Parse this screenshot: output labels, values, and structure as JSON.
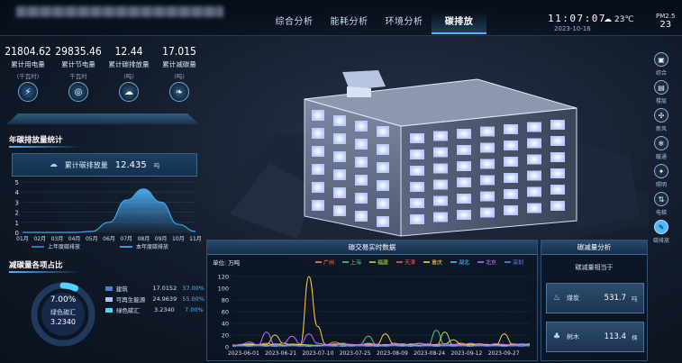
{
  "header": {
    "tabs": [
      {
        "label": "综合分析",
        "active": false
      },
      {
        "label": "能耗分析",
        "active": false
      },
      {
        "label": "环境分析",
        "active": false
      },
      {
        "label": "碳排放",
        "active": true
      }
    ],
    "time": "11:07:07",
    "date": "2023-10-16",
    "weather_icon": "cloud-sun-icon",
    "temperature": "23℃",
    "pm_label": "PM2.5",
    "pm_value": "23"
  },
  "stats": [
    {
      "value": "21804.62",
      "label": "累计用电量",
      "unit": "(千瓦时)",
      "icon": "lightning-icon"
    },
    {
      "value": "29835.46",
      "label": "累计节电量",
      "unit": "千瓦时",
      "icon": "target-icon"
    },
    {
      "value": "12.44",
      "label": "累计碳排放量",
      "unit": "(吨)",
      "icon": "cloud-icon"
    },
    {
      "value": "17.015",
      "label": "累计减碳量",
      "unit": "(吨)",
      "icon": "leaf-icon"
    }
  ],
  "annual": {
    "title": "年碳排放量统计",
    "total_label": "累计碳排放量",
    "total_value": "12.435",
    "total_unit": "吨"
  },
  "reduction": {
    "title": "减碳量各项占比",
    "center_percent": "7.00%",
    "center_label": "绿色碳汇",
    "center_value": "3.2340",
    "items": [
      {
        "name": "建筑",
        "value": "17.0152",
        "percent": "37.00%",
        "color": "#4a7fd6"
      },
      {
        "name": "可再生能源",
        "value": "24.9639",
        "percent": "55.00%",
        "color": "#a9c8f2"
      },
      {
        "name": "绿色碳汇",
        "value": "3.2340",
        "percent": "7.00%",
        "color": "#4fd2ff"
      }
    ]
  },
  "rail": [
    {
      "label": "综合",
      "icon": "overview-icon",
      "active": false
    },
    {
      "label": "楼层",
      "icon": "floors-icon",
      "active": false
    },
    {
      "label": "新风",
      "icon": "fan-icon",
      "active": false
    },
    {
      "label": "暖通",
      "icon": "hvac-icon",
      "active": false
    },
    {
      "label": "照明",
      "icon": "light-icon",
      "active": false
    },
    {
      "label": "电梯",
      "icon": "elevator-icon",
      "active": false
    },
    {
      "label": "碳排放",
      "icon": "carbon-icon",
      "active": true
    }
  ],
  "trade": {
    "title": "碳交易实时数据",
    "unit_label": "单位: 万吨"
  },
  "reduction_analysis": {
    "title": "碳减量分析",
    "equivalent": "碳减量相当于",
    "cards": [
      {
        "name": "煤炭",
        "value": "531.7",
        "unit": "吨",
        "icon": "flame-icon"
      },
      {
        "name": "树木",
        "value": "113.4",
        "unit": "棵",
        "icon": "tree-icon"
      }
    ]
  },
  "chart_data": [
    {
      "type": "area",
      "categories": [
        "01月",
        "02月",
        "03月",
        "04月",
        "05月",
        "06月",
        "07月",
        "08月",
        "09月",
        "10月",
        "11月"
      ],
      "series": [
        {
          "name": "上年度碳排放",
          "values": [
            0,
            0,
            0,
            0,
            0.1,
            1.0,
            3.2,
            4.3,
            3.0,
            0.8,
            0.1
          ],
          "color": "#3aa8e8"
        },
        {
          "name": "本年度碳排放",
          "values": [
            0,
            0,
            0,
            0,
            0,
            0,
            0,
            0,
            0,
            0,
            0
          ],
          "color": "#4fd2ff"
        }
      ],
      "ylim": [
        0,
        5
      ],
      "yticks": [
        0,
        1,
        2,
        3,
        4,
        5
      ],
      "legend": "bottom"
    },
    {
      "type": "line",
      "title": "碳交易实时数据",
      "ylabel": "单位: 万吨",
      "x_ticks": [
        "2023-06-01",
        "2023-06-21",
        "2023-07-10",
        "2023-07-25",
        "2023-08-09",
        "2023-08-24",
        "2023-09-12",
        "2023-09-27"
      ],
      "ylim": [
        0,
        120
      ],
      "yticks": [
        0,
        20,
        40,
        60,
        80,
        100,
        120
      ],
      "legend": "top",
      "series": [
        {
          "name": "广州",
          "color": "#ff8c3a",
          "values": [
            2,
            3,
            2,
            4,
            6,
            3,
            2,
            5,
            4,
            3,
            2,
            3,
            8,
            5,
            3,
            2,
            4,
            3,
            2,
            6,
            4,
            3,
            2,
            5,
            3,
            2,
            4,
            6,
            3,
            2,
            4,
            3,
            2,
            5,
            4,
            3
          ]
        },
        {
          "name": "上海",
          "color": "#44d07a",
          "values": [
            1,
            2,
            3,
            2,
            1,
            3,
            2,
            4,
            2,
            1,
            3,
            2,
            5,
            3,
            2,
            4,
            18,
            3,
            2,
            3,
            2,
            5,
            3,
            2,
            28,
            3,
            2,
            4,
            3,
            2,
            3,
            5,
            3,
            2,
            4,
            2
          ]
        },
        {
          "name": "福建",
          "color": "#b7e34a",
          "values": [
            3,
            2,
            4,
            3,
            2,
            5,
            3,
            2,
            4,
            3,
            2,
            3,
            4,
            6,
            3,
            2,
            3,
            2,
            4,
            3,
            5,
            3,
            2,
            3,
            2,
            25,
            3,
            2,
            5,
            3,
            2,
            4,
            3,
            2,
            3,
            2
          ]
        },
        {
          "name": "天津",
          "color": "#ff5a5a",
          "values": [
            1,
            2,
            1,
            3,
            2,
            1,
            2,
            3,
            2,
            1,
            2,
            3,
            2,
            1,
            2,
            3,
            2,
            1,
            2,
            3,
            2,
            1,
            3,
            2,
            1,
            2,
            3,
            2,
            1,
            2,
            3,
            2,
            1,
            2,
            3,
            2
          ]
        },
        {
          "name": "重庆",
          "color": "#ffcf3a",
          "values": [
            2,
            3,
            5,
            3,
            4,
            20,
            6,
            3,
            4,
            120,
            35,
            4,
            3,
            5,
            4,
            3,
            6,
            4,
            22,
            5,
            3,
            4,
            6,
            3,
            4,
            5,
            12,
            4,
            3,
            5,
            4,
            3,
            22,
            4,
            3,
            5
          ]
        },
        {
          "name": "湖北",
          "color": "#3fc7ff",
          "values": [
            1,
            2,
            1,
            3,
            2,
            1,
            2,
            3,
            2,
            1,
            2,
            3,
            2,
            1,
            2,
            3,
            2,
            1,
            2,
            3,
            2,
            1,
            3,
            2,
            1,
            2,
            3,
            2,
            1,
            2,
            3,
            2,
            1,
            2,
            3,
            2
          ]
        },
        {
          "name": "北京",
          "color": "#c76bff",
          "values": [
            2,
            4,
            8,
            3,
            25,
            4,
            6,
            18,
            5,
            22,
            6,
            4,
            3,
            5,
            4,
            3,
            5,
            4,
            3,
            5,
            4,
            3,
            6,
            4,
            3,
            5,
            4,
            3,
            6,
            4,
            3,
            5,
            4,
            3,
            5,
            4
          ]
        },
        {
          "name": "深圳",
          "color": "#5f86ff",
          "values": [
            1,
            2,
            1,
            2,
            1,
            2,
            1,
            2,
            1,
            2,
            1,
            2,
            1,
            2,
            1,
            2,
            1,
            2,
            1,
            2,
            1,
            2,
            1,
            2,
            1,
            2,
            1,
            2,
            1,
            2,
            1,
            2,
            1,
            2,
            1,
            2
          ]
        }
      ]
    }
  ]
}
